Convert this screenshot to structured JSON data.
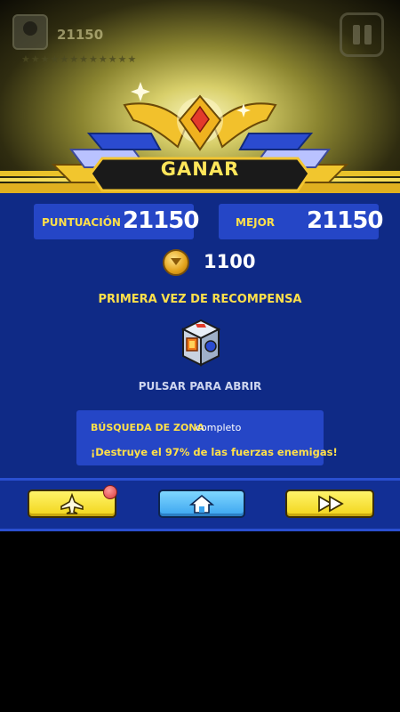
{
  "player": {
    "score": "21150",
    "stars": "★★★★★★★★★★★★"
  },
  "result": {
    "title": "GANAR"
  },
  "stats": {
    "score_label": "PUNTUACIÓN",
    "score_value": "21150",
    "best_label": "MEJOR",
    "best_value": "21150"
  },
  "coins": {
    "value": "1100",
    "icon": "coin-icon"
  },
  "reward": {
    "title": "PRIMERA VEZ DE RECOMPENSA",
    "action": "PULSAR PARA ABRIR",
    "icon": "reward-chest-icon"
  },
  "quest": {
    "title": "BÚSQUEDA DE ZONA",
    "status": "completo",
    "description": "¡Destruye el 97% de las fuerzas enemigas!"
  },
  "buttons": [
    {
      "name": "hangar-button",
      "icon": "plane-icon"
    },
    {
      "name": "home-button",
      "icon": "home-icon"
    },
    {
      "name": "next-button",
      "icon": "fast-forward-icon"
    }
  ],
  "colors": {
    "panel": "#0f2a86",
    "box": "#2546c6",
    "accent": "#ffe04a",
    "gold": "#f1d51a"
  }
}
